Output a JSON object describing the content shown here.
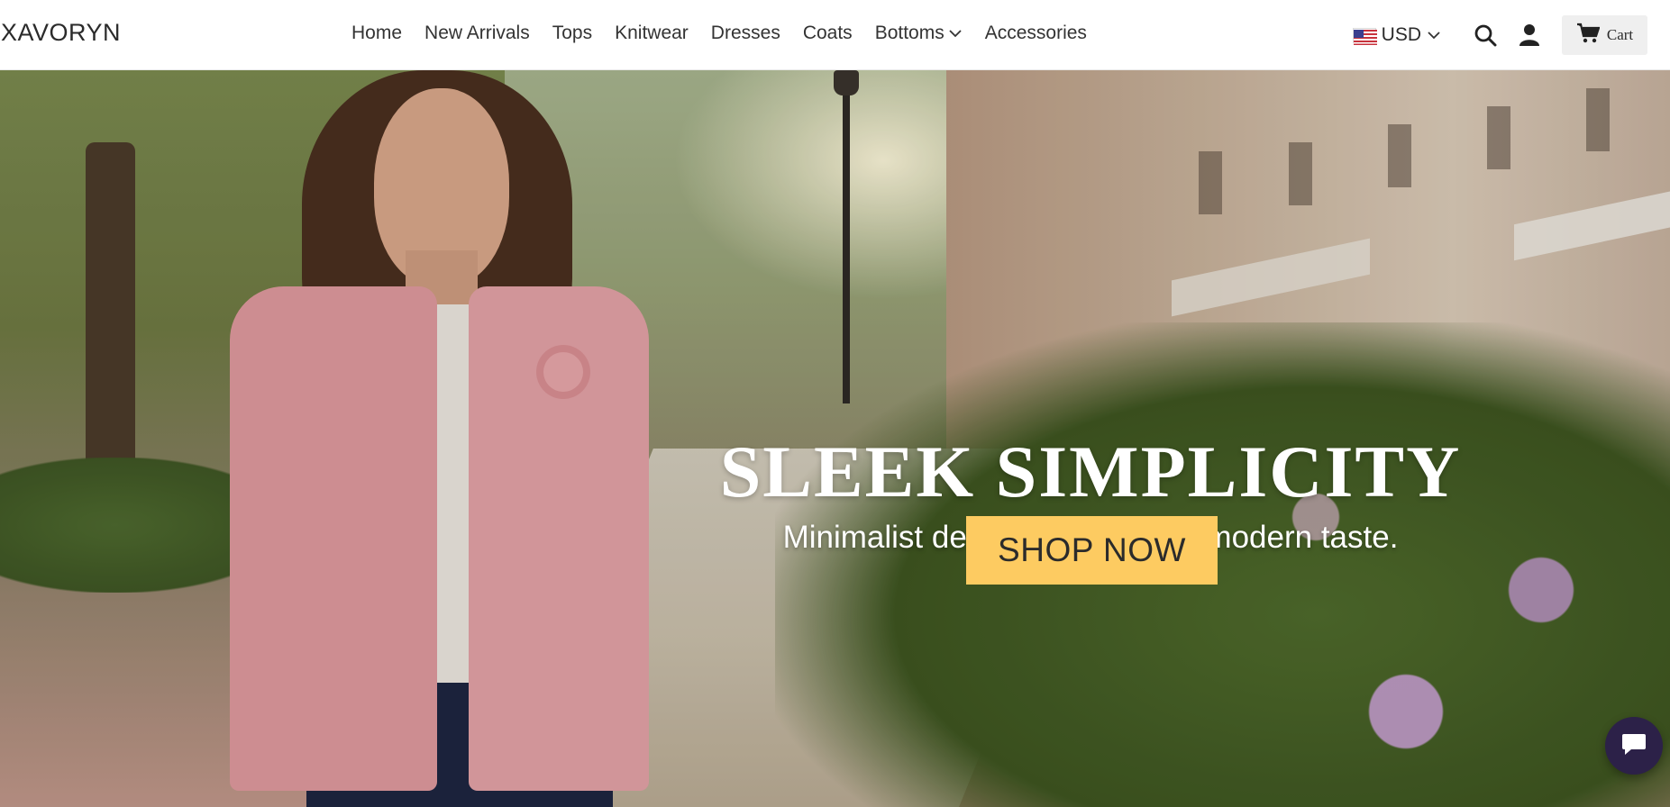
{
  "brand": {
    "logo": "XAVORYN"
  },
  "nav": {
    "items": [
      {
        "label": "Home"
      },
      {
        "label": "New Arrivals"
      },
      {
        "label": "Tops"
      },
      {
        "label": "Knitwear"
      },
      {
        "label": "Dresses"
      },
      {
        "label": "Coats"
      },
      {
        "label": "Bottoms",
        "has_dropdown": true
      },
      {
        "label": "Accessories"
      }
    ]
  },
  "header_tools": {
    "currency": "USD",
    "currency_flag": "us-flag-icon",
    "search_icon": "search-icon",
    "account_icon": "user-icon",
    "cart_label": "Cart",
    "cart_icon": "cart-icon"
  },
  "hero": {
    "title": "SLEEK SIMPLICITY",
    "subtitle": "Minimalist designs that exude modern taste.",
    "cta_label": "SHOP NOW",
    "cta_color": "#fdcb61"
  },
  "chat": {
    "icon": "chat-bubble-icon",
    "color": "#2c2148"
  }
}
